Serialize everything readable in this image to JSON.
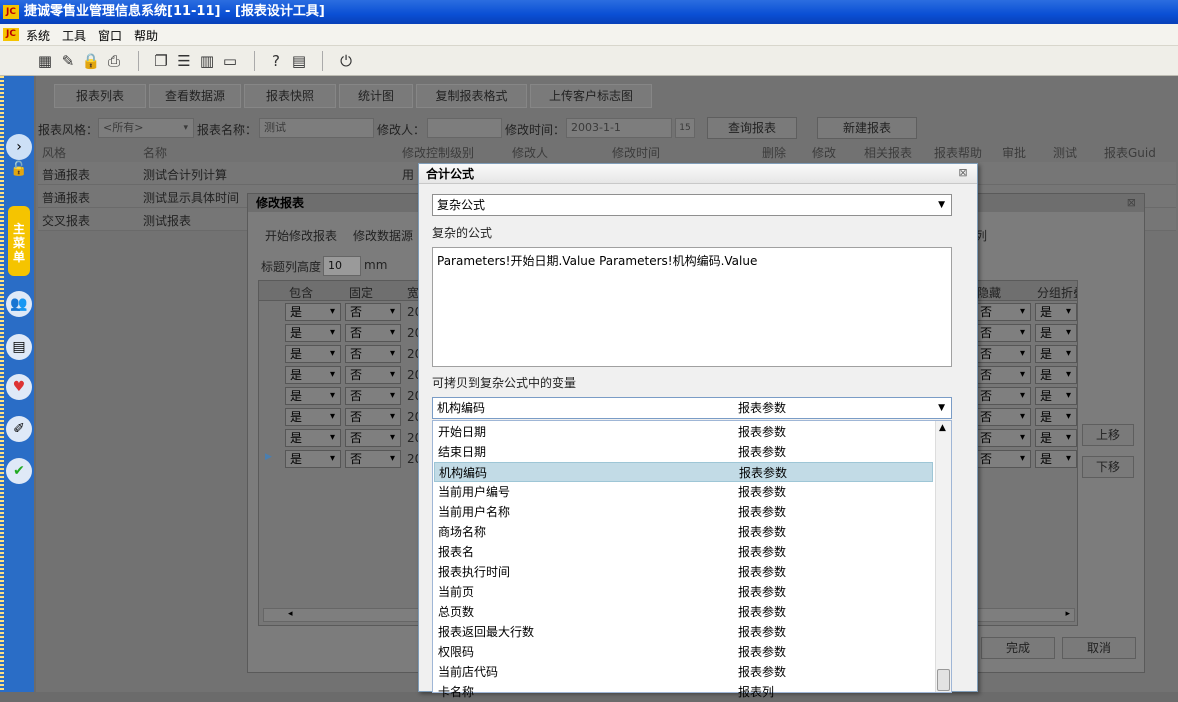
{
  "app": {
    "logo": "JC",
    "title": "捷诚零售业管理信息系统[11-11] - [报表设计工具]"
  },
  "menu": [
    "系统",
    "工具",
    "窗口",
    "帮助"
  ],
  "toolbar_icons": [
    "calculator-icon",
    "pencil-icon",
    "lock-icon",
    "printer-icon",
    "cascade-windows-icon",
    "tile-horizontal-icon",
    "tile-vertical-icon",
    "window-icon",
    "help-icon",
    "document-icon",
    "power-icon"
  ],
  "toolbar_glyphs": [
    "▦",
    "✎",
    "🔒",
    "⎙",
    "❐",
    "☰",
    "▥",
    "▭",
    "?",
    "▤",
    "⏻"
  ],
  "left_nav": {
    "main_menu_label": "主菜单"
  },
  "report_tabs": [
    "报表列表",
    "查看数据源",
    "报表快照",
    "统计图",
    "复制报表格式",
    "上传客户标志图"
  ],
  "filters": {
    "style_label": "报表风格：",
    "style_value": "<所有>",
    "name_label": "报表名称：",
    "name_value": "测试",
    "modifier_label": "修改人：",
    "modifier_value": "",
    "time_label": "修改时间：",
    "time_value": "2003-1-1",
    "calendar": "15",
    "query_button": "查询报表",
    "new_button": "新建报表"
  },
  "grid": {
    "headers": [
      "风格",
      "名称",
      "修改控制级别",
      "修改人",
      "修改时间",
      "删除",
      "修改",
      "相关报表",
      "报表帮助",
      "审批",
      "测试",
      "报表Guid"
    ],
    "rows": [
      {
        "style": "普通报表",
        "name": "测试合计列计算",
        "extra": "用"
      },
      {
        "style": "普通报表",
        "name": "测试显示具体时间",
        "extra": ""
      },
      {
        "style": "交叉报表",
        "name": "测试报表",
        "extra": ""
      }
    ]
  },
  "edit_dialog": {
    "title": "修改报表",
    "actions": [
      "开始修改报表",
      "修改数据源"
    ],
    "right_action": "列",
    "height_label": "标题列高度",
    "height_value": "10",
    "height_unit": "mm",
    "col_headers": {
      "include": "包含",
      "fixed": "固定",
      "width": "宽",
      "hidden": "隐藏",
      "group_fold": "分组折叠"
    },
    "rows": [
      {
        "include": "是",
        "fixed": "否",
        "width": "20",
        "hidden": "否",
        "fold": "是"
      },
      {
        "include": "是",
        "fixed": "否",
        "width": "20",
        "hidden": "否",
        "fold": "是"
      },
      {
        "include": "是",
        "fixed": "否",
        "width": "20",
        "hidden": "否",
        "fold": "是"
      },
      {
        "include": "是",
        "fixed": "否",
        "width": "20",
        "hidden": "否",
        "fold": "是"
      },
      {
        "include": "是",
        "fixed": "否",
        "width": "20",
        "hidden": "否",
        "fold": "是"
      },
      {
        "include": "是",
        "fixed": "否",
        "width": "20",
        "hidden": "否",
        "fold": "是"
      },
      {
        "include": "是",
        "fixed": "否",
        "width": "20",
        "hidden": "否",
        "fold": "是"
      },
      {
        "include": "是",
        "fixed": "否",
        "width": "20",
        "hidden": "否",
        "fold": "是"
      }
    ],
    "up_button": "上移",
    "down_button": "下移",
    "finish_button": "完成",
    "cancel_button": "取消"
  },
  "formula_dialog": {
    "title": "合计公式",
    "type_value": "复杂公式",
    "formula_label": "复杂的公式",
    "formula_text": "Parameters!开始日期.Value    Parameters!机构编码.Value",
    "vars_label": "可拷贝到复杂公式中的变量",
    "selected_name": "机构编码",
    "selected_type": "报表参数",
    "variables": [
      {
        "name": "开始日期",
        "type": "报表参数"
      },
      {
        "name": "结束日期",
        "type": "报表参数"
      },
      {
        "name": "机构编码",
        "type": "报表参数"
      },
      {
        "name": "当前用户编号",
        "type": "报表参数"
      },
      {
        "name": "当前用户名称",
        "type": "报表参数"
      },
      {
        "name": "商场名称",
        "type": "报表参数"
      },
      {
        "name": "报表名",
        "type": "报表参数"
      },
      {
        "name": "报表执行时间",
        "type": "报表参数"
      },
      {
        "name": "当前页",
        "type": "报表参数"
      },
      {
        "name": "总页数",
        "type": "报表参数"
      },
      {
        "name": "报表返回最大行数",
        "type": "报表参数"
      },
      {
        "name": "权限码",
        "type": "报表参数"
      },
      {
        "name": "当前店代码",
        "type": "报表参数"
      },
      {
        "name": "卡名称",
        "type": "报表列"
      }
    ]
  }
}
